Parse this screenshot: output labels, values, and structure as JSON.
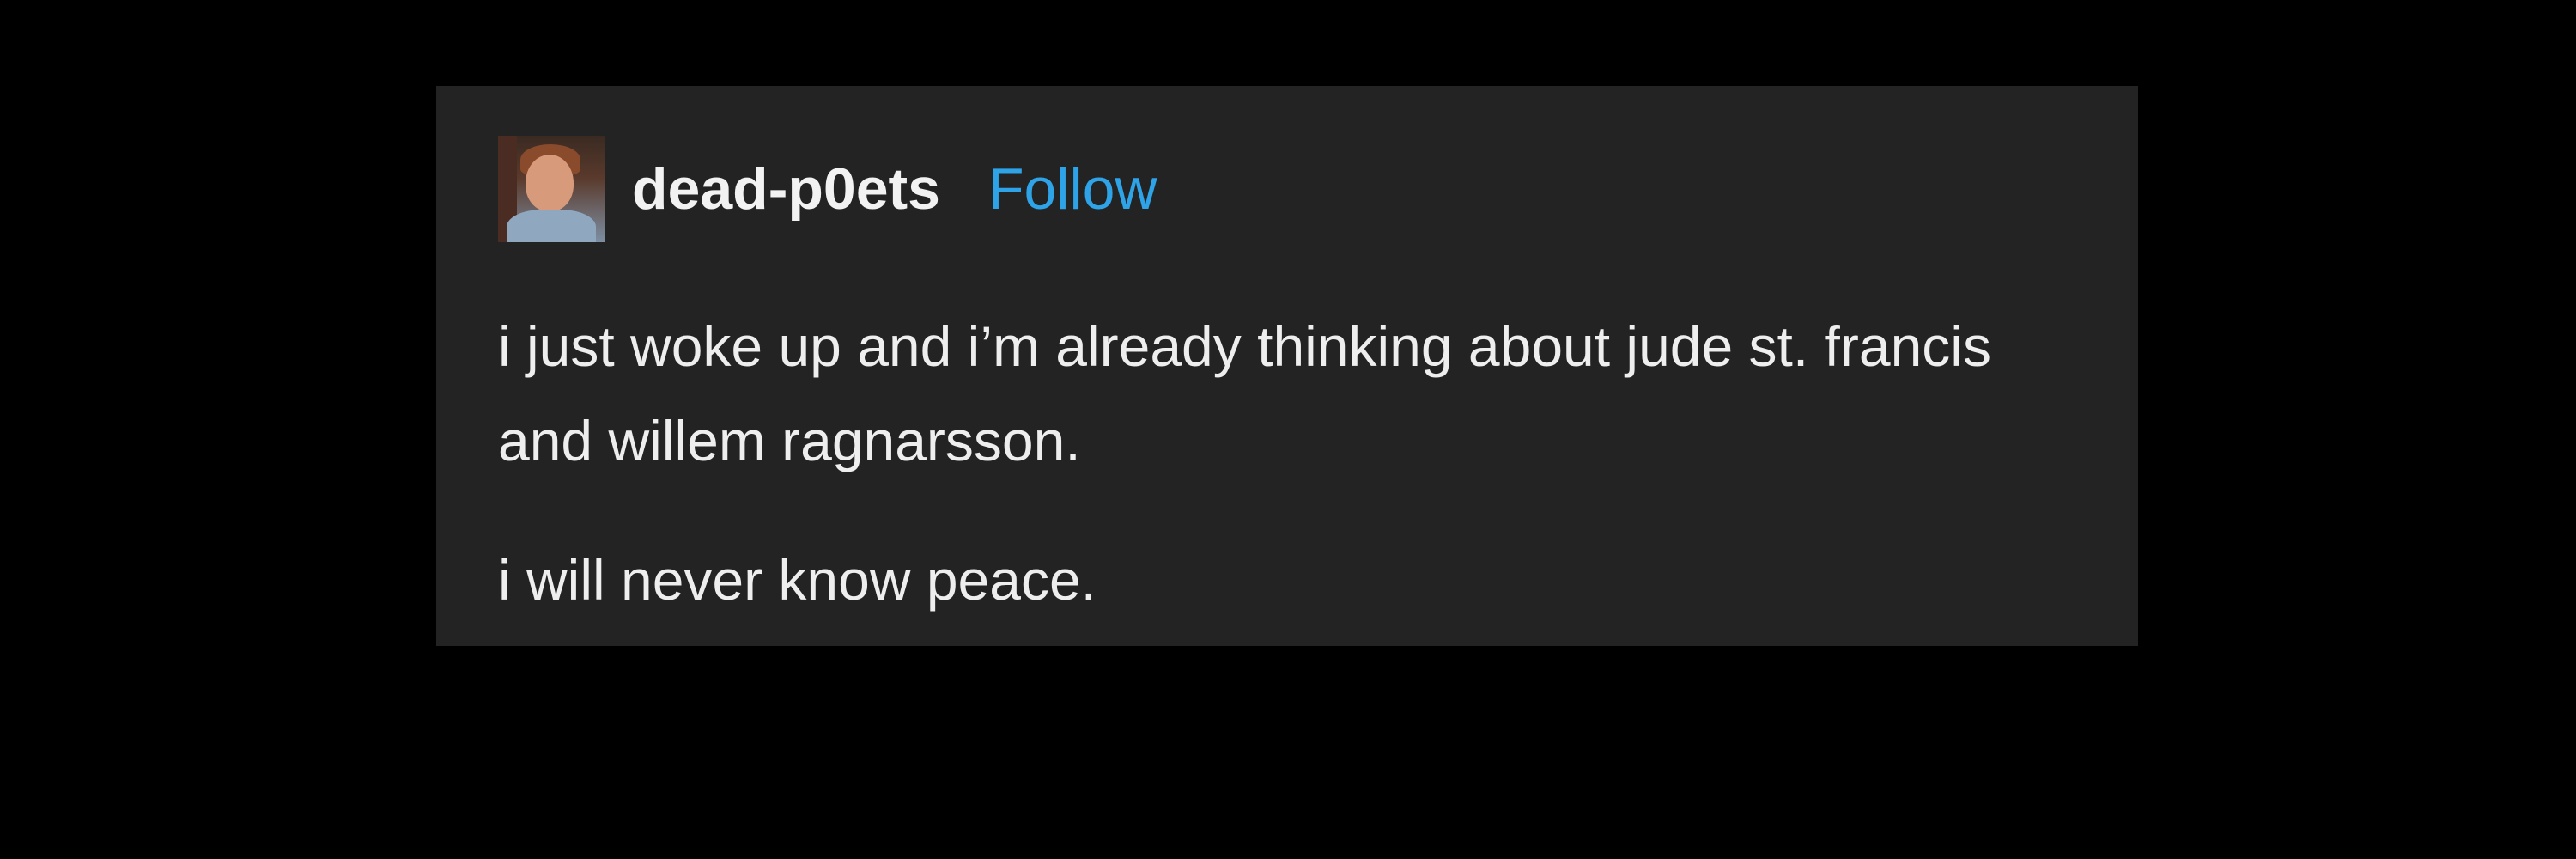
{
  "post": {
    "username": "dead-p0ets",
    "follow_label": "Follow",
    "paragraphs": [
      "i just woke up and i’m already thinking about jude st. francis and willem ragnarsson.",
      "i will never know peace."
    ]
  },
  "colors": {
    "page_background": "#000000",
    "card_background": "#232323",
    "username": "#f2f2f2",
    "follow_link": "#2ea3e8",
    "body_text": "#eeeeee"
  },
  "icons": {
    "avatar": "user-avatar-photo"
  }
}
